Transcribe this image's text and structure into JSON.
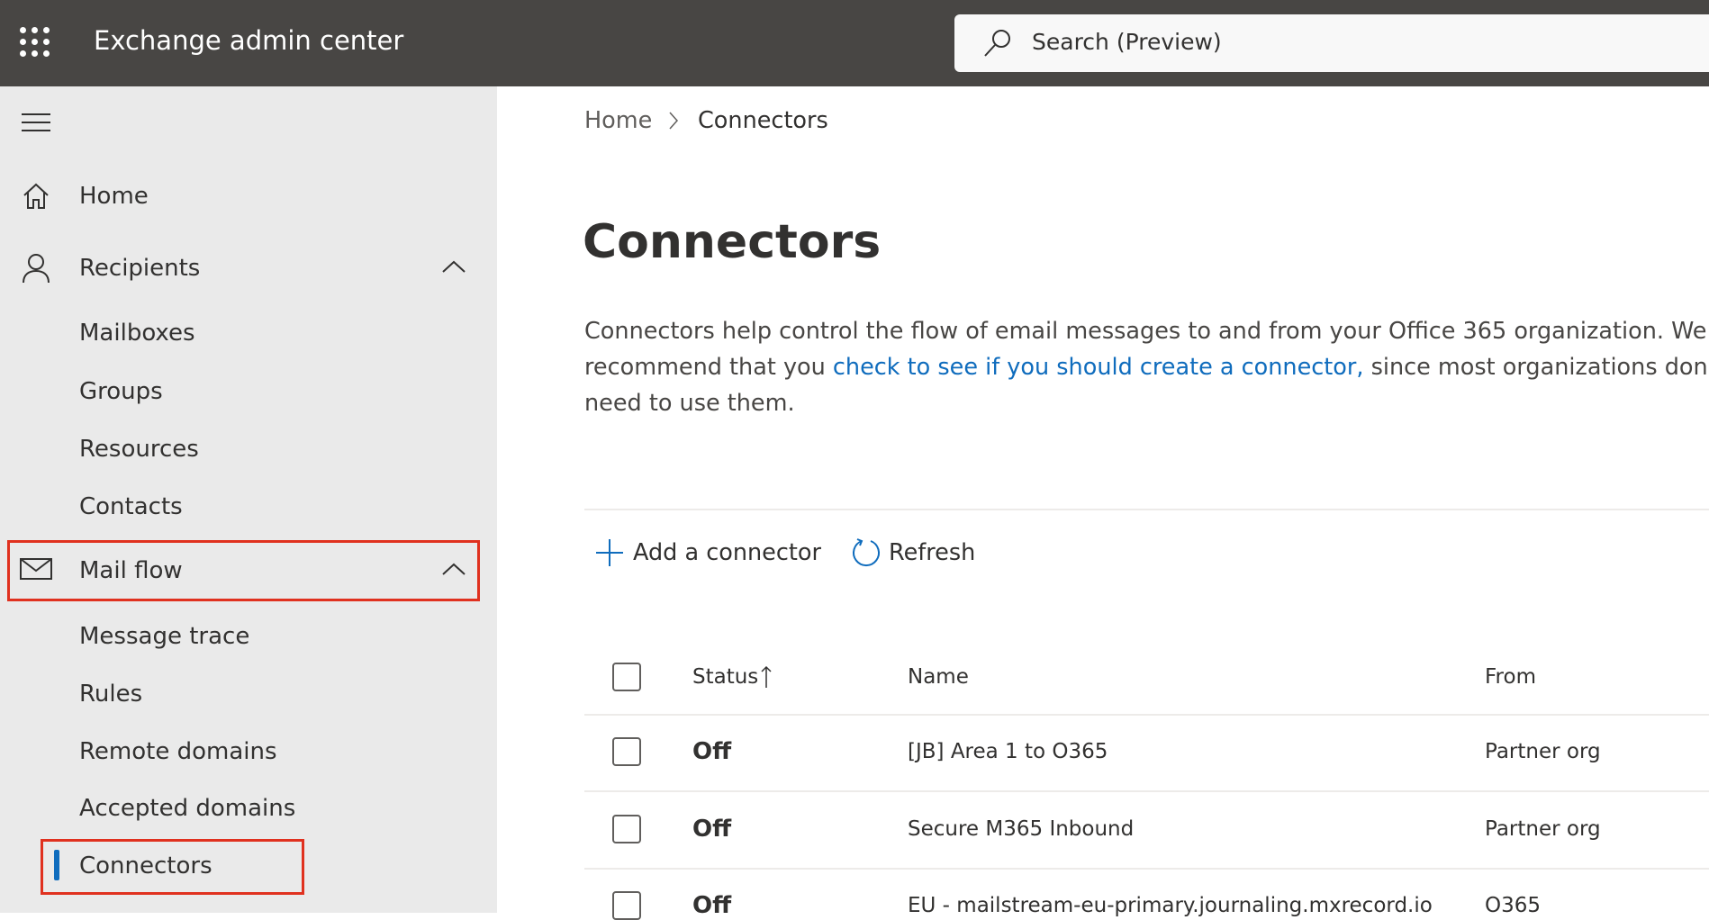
{
  "header": {
    "app_title": "Exchange admin center",
    "search_placeholder": "Search (Preview)"
  },
  "sidebar": {
    "items": [
      {
        "label": "Home"
      },
      {
        "label": "Recipients"
      },
      {
        "label": "Mailboxes"
      },
      {
        "label": "Groups"
      },
      {
        "label": "Resources"
      },
      {
        "label": "Contacts"
      },
      {
        "label": "Mail flow"
      },
      {
        "label": "Message trace"
      },
      {
        "label": "Rules"
      },
      {
        "label": "Remote domains"
      },
      {
        "label": "Accepted domains"
      },
      {
        "label": "Connectors"
      }
    ]
  },
  "breadcrumb": {
    "home": "Home",
    "current": "Connectors"
  },
  "page": {
    "title": "Connectors",
    "desc_1": "Connectors help control the flow of email messages to and from your Office 365 organization. We recommend that you ",
    "desc_link": "check to see if you should create a connector,",
    "desc_2": " since most organizations don't need to use them."
  },
  "toolbar": {
    "add": "Add a connector",
    "refresh": "Refresh"
  },
  "table": {
    "headers": {
      "status": "Status",
      "name": "Name",
      "from": "From"
    },
    "rows": [
      {
        "status": "Off",
        "name": "[JB] Area 1 to O365",
        "from": "Partner org"
      },
      {
        "status": "Off",
        "name": "Secure M365 Inbound",
        "from": "Partner org"
      },
      {
        "status": "Off",
        "name": "EU - mailstream-eu-primary.journaling.mxrecord.io",
        "from": "O365"
      }
    ]
  },
  "colors": {
    "topbar": "#484644",
    "accent": "#0f6cbd",
    "highlight": "#e0311f"
  }
}
